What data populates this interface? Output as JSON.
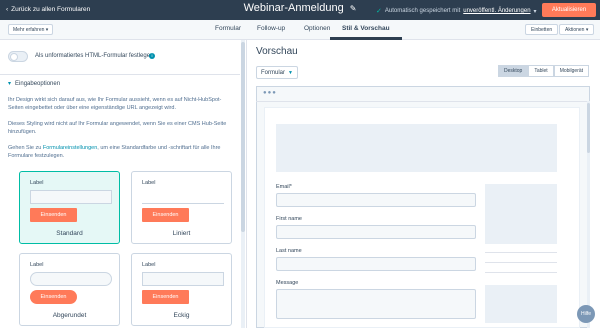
{
  "topbar": {
    "back_label": "Zurück zu allen Formularen",
    "title": "Webinar-Anmeldung",
    "autosave_prefix": "Automatisch gespeichert mit",
    "autosave_link": "unveröffentl. Änderungen",
    "update_label": "Aktualisieren"
  },
  "tabbar": {
    "more_label": "Mehr erfahren ▾",
    "tabs": [
      "Formular",
      "Follow-up",
      "Optionen",
      "Stil & Vorschau"
    ],
    "embed_label": "Einbetten",
    "actions_label": "Aktionen ▾"
  },
  "left": {
    "toggle_label": "Als unformatiertes HTML-Formular festlegen",
    "section_title": "Eingabeoptionen",
    "para1": "Ihr Design wirkt sich darauf aus, wie Ihr Formular aussieht, wenn es auf Nicht-HubSpot-Seiten eingebettet oder über eine eigenständige URL angezeigt wird.",
    "para2": "Dieses Styling wird nicht auf Ihr Formular angewendet, wenn Sie es einer CMS Hub-Seite hinzufügen.",
    "para3_prefix": "Gehen Sie zu ",
    "para3_link": "Formulareinstellungen",
    "para3_suffix": ", um eine Standardfarbe und -schriftart für alle Ihre Formulare festzulegen.",
    "cards": [
      {
        "label": "Label",
        "button": "Einsenden",
        "name": "Standard"
      },
      {
        "label": "Label",
        "button": "Einsenden",
        "name": "Liniert"
      },
      {
        "label": "Label",
        "button": "Einsenden",
        "name": "Abgerundet"
      },
      {
        "label": "Label",
        "button": "Einsenden",
        "name": "Eckig"
      }
    ]
  },
  "preview": {
    "title": "Vorschau",
    "select_value": "Formular",
    "devices": [
      "Desktop",
      "Tablet",
      "Mobilgerät"
    ],
    "fields": [
      "Email*",
      "First name",
      "Last name",
      "Message"
    ]
  },
  "help_label": "Hilfe",
  "colors": {
    "topbar": "#2d3e50",
    "accent_orange": "#ff7a59",
    "teal": "#00bda5",
    "link": "#0091ae"
  }
}
